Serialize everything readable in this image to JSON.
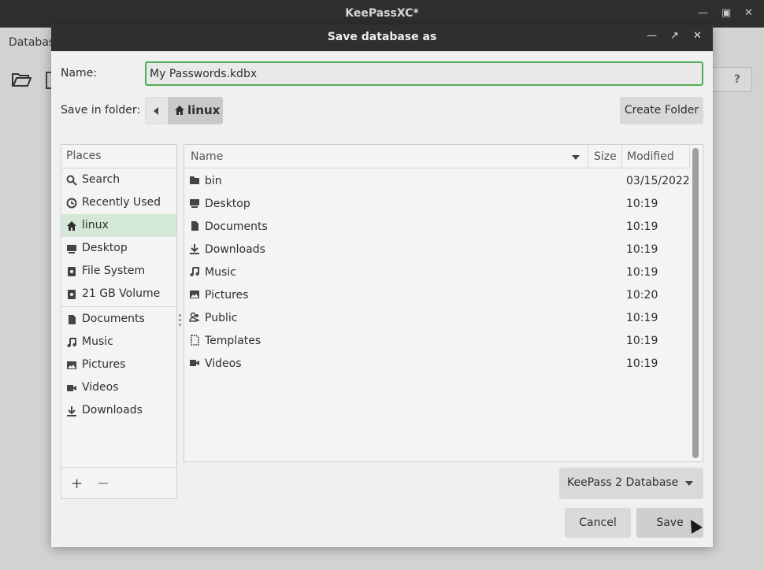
{
  "app": {
    "title": "KeePassXC*",
    "menu_label": "Databas",
    "help_label": "?"
  },
  "dialog": {
    "title": "Save database as",
    "name_label": "Name:",
    "name_value": "My Passwords.kdbx",
    "save_in_label": "Save in folder:",
    "current_folder": "linux",
    "create_folder_label": "Create Folder",
    "filter_value": "KeePass 2 Database",
    "cancel_label": "Cancel",
    "save_label": "Save"
  },
  "places": {
    "header": "Places",
    "items": [
      {
        "label": "Search",
        "icon": "search-icon"
      },
      {
        "label": "Recently Used",
        "icon": "clock-icon"
      },
      {
        "label": "linux",
        "icon": "home-icon",
        "active": true
      },
      {
        "label": "Desktop",
        "icon": "desktop-icon"
      },
      {
        "label": "File System",
        "icon": "drive-icon"
      },
      {
        "label": "21 GB Volume",
        "icon": "drive-icon"
      },
      {
        "label": "Documents",
        "icon": "document-icon"
      },
      {
        "label": "Music",
        "icon": "music-icon"
      },
      {
        "label": "Pictures",
        "icon": "image-icon"
      },
      {
        "label": "Videos",
        "icon": "video-icon"
      },
      {
        "label": "Downloads",
        "icon": "download-icon"
      }
    ],
    "add_label": "+",
    "remove_label": "—"
  },
  "files": {
    "columns": {
      "name": "Name",
      "size": "Size",
      "modified": "Modified"
    },
    "rows": [
      {
        "name": "bin",
        "modified": "03/15/2022",
        "icon": "folder-icon"
      },
      {
        "name": "Desktop",
        "modified": "10:19",
        "icon": "desktop-icon"
      },
      {
        "name": "Documents",
        "modified": "10:19",
        "icon": "document-icon"
      },
      {
        "name": "Downloads",
        "modified": "10:19",
        "icon": "download-icon"
      },
      {
        "name": "Music",
        "modified": "10:19",
        "icon": "music-icon"
      },
      {
        "name": "Pictures",
        "modified": "10:20",
        "icon": "image-icon"
      },
      {
        "name": "Public",
        "modified": "10:19",
        "icon": "people-icon"
      },
      {
        "name": "Templates",
        "modified": "10:19",
        "icon": "template-icon"
      },
      {
        "name": "Videos",
        "modified": "10:19",
        "icon": "video-icon"
      }
    ]
  }
}
